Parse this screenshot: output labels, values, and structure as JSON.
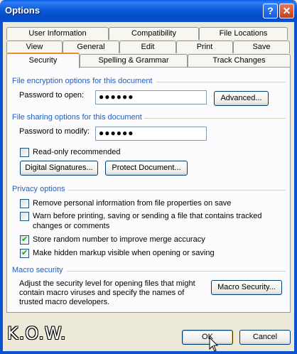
{
  "window": {
    "title": "Options",
    "help_glyph": "?",
    "close_glyph": "✕"
  },
  "tabs_row1": [
    "User Information",
    "Compatibility",
    "File Locations"
  ],
  "tabs_row2": [
    "View",
    "General",
    "Edit",
    "Print",
    "Save"
  ],
  "tabs_row3": [
    "Security",
    "Spelling & Grammar",
    "Track Changes"
  ],
  "active_tab": "Security",
  "encryption": {
    "section_label": "File encryption options for this document",
    "password_label": "Password to open:",
    "password_value": "●●●●●●",
    "advanced_button": "Advanced..."
  },
  "sharing": {
    "section_label": "File sharing options for this document",
    "password_label": "Password to modify:",
    "password_value": "●●●●●●",
    "readonly_label": "Read-only recommended",
    "readonly_checked": false,
    "digital_signatures_button": "Digital Signatures...",
    "protect_document_button": "Protect Document..."
  },
  "privacy": {
    "section_label": "Privacy options",
    "opt1": "Remove personal information from file properties on save",
    "opt2_line1": "Warn before printing, saving or sending a file that contains tracked",
    "opt2_line2": "changes or comments",
    "opt3": "Store random number to improve merge accuracy",
    "opt4": "Make hidden markup visible when opening or saving",
    "checked": [
      false,
      false,
      true,
      true
    ]
  },
  "macro": {
    "section_label": "Macro security",
    "desc_line1": "Adjust the security level for opening files that might",
    "desc_line2": "contain macro viruses and specify the names of",
    "desc_line3": "trusted macro developers.",
    "button": "Macro Security..."
  },
  "footer": {
    "ok": "OK",
    "cancel": "Cancel"
  },
  "watermark": "K.O.W."
}
